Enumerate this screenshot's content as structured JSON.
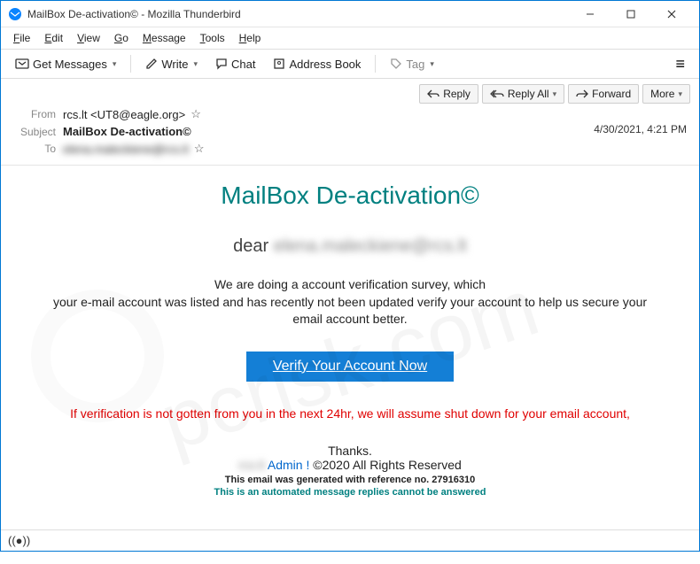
{
  "window": {
    "title": "MailBox De-activation© - Mozilla Thunderbird"
  },
  "menubar": {
    "file": "File",
    "edit": "Edit",
    "view": "View",
    "go": "Go",
    "message": "Message",
    "tools": "Tools",
    "help": "Help"
  },
  "toolbar": {
    "get_messages": "Get Messages",
    "write": "Write",
    "chat": "Chat",
    "address_book": "Address Book",
    "tag": "Tag"
  },
  "actions": {
    "reply": "Reply",
    "reply_all": "Reply All",
    "forward": "Forward",
    "more": "More"
  },
  "meta": {
    "from_label": "From",
    "from_value": "rcs.lt <UT8@eagle.org>",
    "subject_label": "Subject",
    "subject_value": "MailBox De-activation©",
    "to_label": "To",
    "to_value": "elena.maleckiene@rcs.lt",
    "datetime": "4/30/2021, 4:21 PM"
  },
  "body": {
    "heading": "MailBox De-activation©",
    "dear_prefix": "dear ",
    "dear_blur": "elena.maleckiene@rcs.lt",
    "para": "We are doing a account  verification survey, which\nyour e-mail account  was listed  and has  recently not  been updated  verify your account  to help us secure your email account better.",
    "cta": "Verify Your Account Now",
    "warn": "If verification is not gotten from you in the next 24hr, we will assume shut down for your email account,",
    "thanks": "Thanks.",
    "admin_blur": "rcs.lt",
    "admin": " Admin !",
    "rights": "   ©2020 All Rights Reserved",
    "ref": "This email was generated  with reference no.  27916310",
    "auto": "This is an automated message replies cannot be answered"
  },
  "watermark": "pcrisk.com"
}
